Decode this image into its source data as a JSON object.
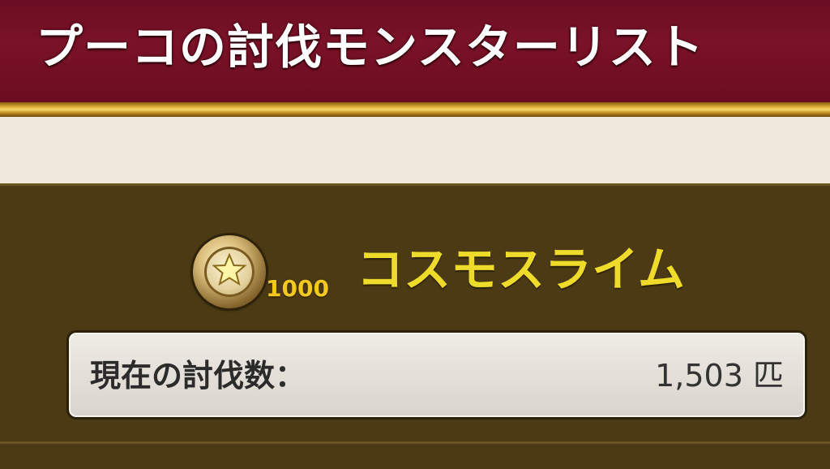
{
  "header": {
    "title": "プーコの討伐モンスターリスト"
  },
  "monster": {
    "medal_icon": "star-medal-icon",
    "medal_count": "1000",
    "name": "コスモスライム",
    "name_color": "#eedb2a"
  },
  "kill_count": {
    "label": "現在の討伐数：",
    "value": "1,503 匹"
  },
  "colors": {
    "header_bg": "#7a1228",
    "gold_rule": "#e2b53a",
    "panel_bg": "#4b3a14",
    "cream": "#efe9dc"
  }
}
